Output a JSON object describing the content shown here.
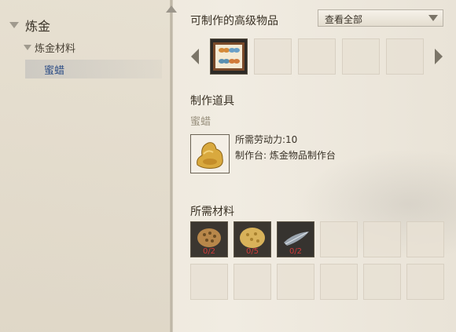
{
  "tree": {
    "category": "炼金",
    "subcategory": "炼金材料",
    "selected_item": "蜜蜡"
  },
  "right": {
    "craftable_title": "可制作的高级物品",
    "filter_value": "查看全部",
    "tool_section_title": "制作道具",
    "tool_name": "蜜蜡",
    "labor_text": "所需劳动力:10",
    "workbench_text": "制作台: 炼金物品制作台",
    "materials_title": "所需材料",
    "materials": [
      {
        "count": "0/2",
        "icon": "mushroom-icon"
      },
      {
        "count": "0/5",
        "icon": "sponge-icon"
      },
      {
        "count": "0/2",
        "icon": "feather-icon"
      }
    ]
  }
}
